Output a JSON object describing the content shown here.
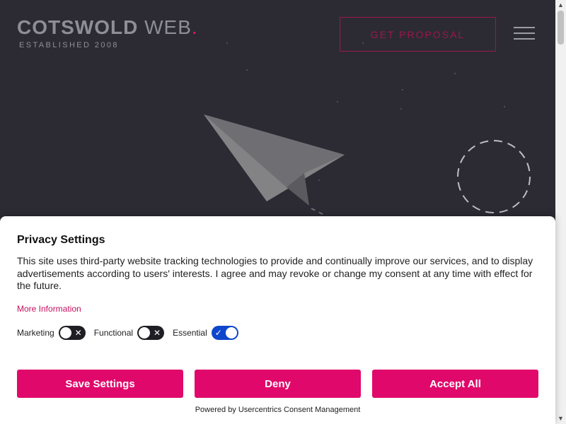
{
  "header": {
    "logo_main_bold": "COTSWOLD",
    "logo_main_light": " WEB",
    "logo_dot": ".",
    "logo_sub": "ESTABLISHED 2008",
    "cta_label": "GET PROPOSAL",
    "menu_icon": "hamburger-menu-icon"
  },
  "consent": {
    "title": "Privacy Settings",
    "description": "This site uses third-party website tracking technologies to provide and continually improve our services, and to display advertisements according to users' interests. I agree and may revoke or change my consent at any time with effect for the future.",
    "more_info": "More Information",
    "toggles": [
      {
        "label": "Marketing",
        "state": "off",
        "icon": "✕"
      },
      {
        "label": "Functional",
        "state": "off",
        "icon": "✕"
      },
      {
        "label": "Essential",
        "state": "on",
        "icon": "✓"
      }
    ],
    "buttons": {
      "save": "Save Settings",
      "deny": "Deny",
      "accept": "Accept All"
    },
    "powered_by": "Powered by Usercentrics Consent Management"
  },
  "colors": {
    "background": "#2c2b34",
    "accent": "#e0096b",
    "toggle_on": "#0e47cb",
    "toggle_off": "#1e1e24"
  },
  "scrollbar": {
    "up_icon": "▲",
    "down_icon": "▼"
  }
}
